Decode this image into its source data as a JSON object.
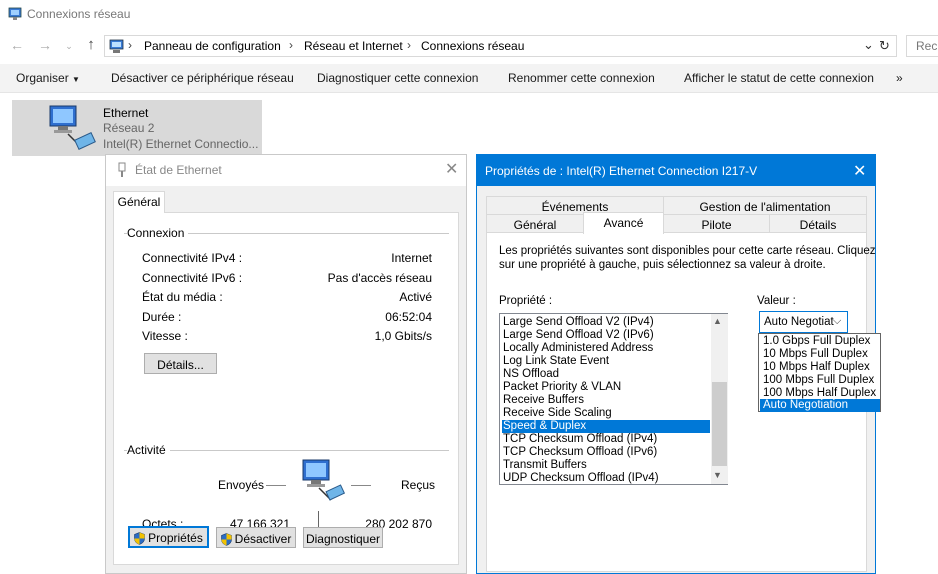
{
  "window": {
    "title": "Connexions réseau"
  },
  "address": {
    "crumbs": [
      "Panneau de configuration",
      "Réseau et Internet",
      "Connexions réseau"
    ],
    "search_placeholder": "Rech"
  },
  "commands": [
    "Organiser",
    "Désactiver ce périphérique réseau",
    "Diagnostiquer cette connexion",
    "Renommer cette connexion",
    "Afficher le statut de cette connexion",
    "»"
  ],
  "ethernet_item": {
    "name": "Ethernet",
    "network": "Réseau  2",
    "adapter": "Intel(R) Ethernet Connectio..."
  },
  "status_dialog": {
    "title": "État de Ethernet",
    "tab": "Général",
    "connection_group": "Connexion",
    "rows": [
      {
        "label": "Connectivité IPv4 :",
        "value": "Internet"
      },
      {
        "label": "Connectivité IPv6 :",
        "value": "Pas d'accès réseau"
      },
      {
        "label": "État du média :",
        "value": "Activé"
      },
      {
        "label": "Durée :",
        "value": "06:52:04"
      },
      {
        "label": "Vitesse :",
        "value": "1,0 Gbits/s"
      }
    ],
    "details_button": "Détails...",
    "activity_group": "Activité",
    "sent_label": "Envoyés",
    "received_label": "Reçus",
    "bytes_label": "Octets :",
    "bytes_sent": "47 166 321",
    "bytes_received": "280 202 870",
    "buttons": {
      "properties": "Propriétés",
      "disable": "Désactiver",
      "diagnose": "Diagnostiquer"
    }
  },
  "props_dialog": {
    "title": "Propriétés de : Intel(R) Ethernet Connection I217-V",
    "tabs_top": [
      "Événements",
      "Gestion de l'alimentation"
    ],
    "tabs_bottom": [
      "Général",
      "Avancé",
      "Pilote",
      "Détails"
    ],
    "active_tab": "Avancé",
    "description": [
      "Les propriétés suivantes sont disponibles pour cette carte réseau. Cliquez",
      "sur une propriété à gauche, puis sélectionnez sa valeur à droite."
    ],
    "property_label": "Propriété :",
    "value_label": "Valeur :",
    "properties": [
      "Large Send Offload V2 (IPv4)",
      "Large Send Offload V2 (IPv6)",
      "Locally Administered Address",
      "Log Link State Event",
      "NS Offload",
      "Packet Priority & VLAN",
      "Receive Buffers",
      "Receive Side Scaling",
      "Speed & Duplex",
      "TCP Checksum Offload (IPv4)",
      "TCP Checksum Offload (IPv6)",
      "Transmit Buffers",
      "UDP Checksum Offload (IPv4)"
    ],
    "selected_property": "Speed & Duplex",
    "combo_value": "Auto Negotiat",
    "options": [
      "1.0 Gbps Full Duplex",
      "10 Mbps Full Duplex",
      "10 Mbps Half Duplex",
      "100 Mbps Full Duplex",
      "100 Mbps Half Duplex",
      "Auto Negotiation"
    ],
    "selected_option": "Auto Negotiation"
  },
  "colors": {
    "accent": "#0078d7",
    "dialog_bg": "#f0f0f0",
    "item_selected_bg": "#d9d9d9"
  }
}
